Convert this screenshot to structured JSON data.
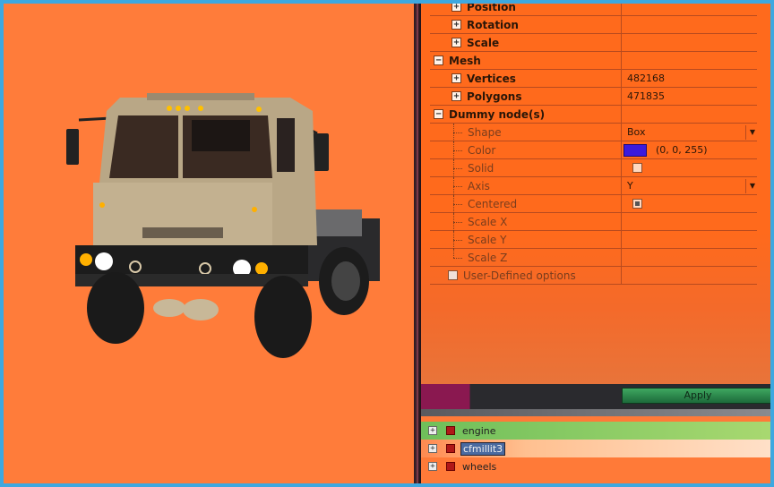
{
  "properties": {
    "transform": {
      "position_label": "Position",
      "rotation_label": "Rotation",
      "scale_label": "Scale"
    },
    "mesh": {
      "label": "Mesh",
      "vertices_label": "Vertices",
      "vertices_value": "482168",
      "polygons_label": "Polygons",
      "polygons_value": "471835"
    },
    "dummy": {
      "label": "Dummy node(s)",
      "shape_label": "Shape",
      "shape_value": "Box",
      "color_label": "Color",
      "color_value": "(0, 0, 255)",
      "color_hex": "#3b1adc",
      "solid_label": "Solid",
      "solid_checked": false,
      "axis_label": "Axis",
      "axis_value": "Y",
      "centered_label": "Centered",
      "centered_checked": true,
      "scalex_label": "Scale X",
      "scaley_label": "Scale Y",
      "scalez_label": "Scale Z"
    },
    "user_defined_label": "User-Defined options"
  },
  "apply_label": "Apply",
  "nodes": [
    {
      "label": "engine",
      "selected": false
    },
    {
      "label": "cfmillit3",
      "selected": true
    },
    {
      "label": "wheels",
      "selected": false
    }
  ],
  "colors": {
    "viewport_bg": "#ff7c3a",
    "panel_bg": "#ff6a1c",
    "apply_btn": "#2e8a4e",
    "selection": "#4a6aa0"
  }
}
